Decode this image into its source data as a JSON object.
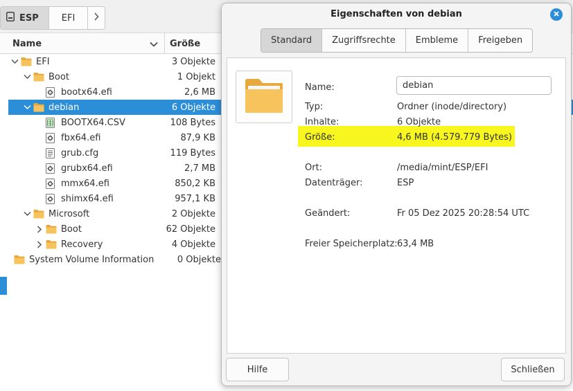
{
  "pathbar": {
    "crumbs": [
      {
        "label": "ESP",
        "icon": "drive-icon"
      },
      {
        "label": "EFI"
      }
    ]
  },
  "columns": {
    "name": "Name",
    "size": "Größe"
  },
  "tree": [
    {
      "label": "EFI",
      "size": "3 Objekte",
      "type": "folder",
      "expanded": true,
      "level": 0
    },
    {
      "label": "Boot",
      "size": "1 Objekt",
      "type": "folder",
      "expanded": true,
      "level": 1
    },
    {
      "label": "bootx64.efi",
      "size": "2,6 MB",
      "type": "binary",
      "level": 2
    },
    {
      "label": "debian",
      "size": "6 Objekte",
      "type": "folder",
      "expanded": true,
      "level": 1,
      "selected": true
    },
    {
      "label": "BOOTX64.CSV",
      "size": "108 Bytes",
      "type": "spreadsheet",
      "level": 2
    },
    {
      "label": "fbx64.efi",
      "size": "87,9 KB",
      "type": "binary",
      "level": 2
    },
    {
      "label": "grub.cfg",
      "size": "119 Bytes",
      "type": "text",
      "level": 2
    },
    {
      "label": "grubx64.efi",
      "size": "2,7 MB",
      "type": "binary",
      "level": 2
    },
    {
      "label": "mmx64.efi",
      "size": "850,2 KB",
      "type": "binary",
      "level": 2
    },
    {
      "label": "shimx64.efi",
      "size": "957,1 KB",
      "type": "binary",
      "level": 2
    },
    {
      "label": "Microsoft",
      "size": "2 Objekte",
      "type": "folder",
      "expanded": true,
      "level": 1
    },
    {
      "label": "Boot",
      "size": "62 Objekte",
      "type": "folder",
      "expanded": false,
      "level": 2
    },
    {
      "label": "Recovery",
      "size": "4 Objekte",
      "type": "folder",
      "expanded": false,
      "level": 2
    },
    {
      "label": "System Volume Information",
      "size": "0 Objekte",
      "type": "folder",
      "level": 0
    }
  ],
  "dialog": {
    "title": "Eigenschaften von debian",
    "tabs": [
      "Standard",
      "Zugriffsrechte",
      "Embleme",
      "Freigeben"
    ],
    "active_tab": "Standard",
    "fields": {
      "name_label": "Name:",
      "name_value": "debian",
      "type_label": "Typ:",
      "type_value": "Ordner (inode/directory)",
      "contents_label": "Inhalte:",
      "contents_value": "6 Objekte",
      "size_label": "Größe:",
      "size_value": "4,6 MB (4.579.779 Bytes)",
      "location_label": "Ort:",
      "location_value": "/media/mint/ESP/EFI",
      "volume_label": "Datenträger:",
      "volume_value": "ESP",
      "modified_label": "Geändert:",
      "modified_value": "Fr 05 Dez 2025 20:28:54 UTC",
      "free_label": "Freier Speicherplatz:",
      "free_value": "63,4 MB"
    },
    "help_button": "Hilfe",
    "close_button": "Schließen"
  },
  "colors": {
    "selection": "#2d8ed8",
    "highlight": "#f7f61f",
    "folder": "#f6c35c"
  }
}
